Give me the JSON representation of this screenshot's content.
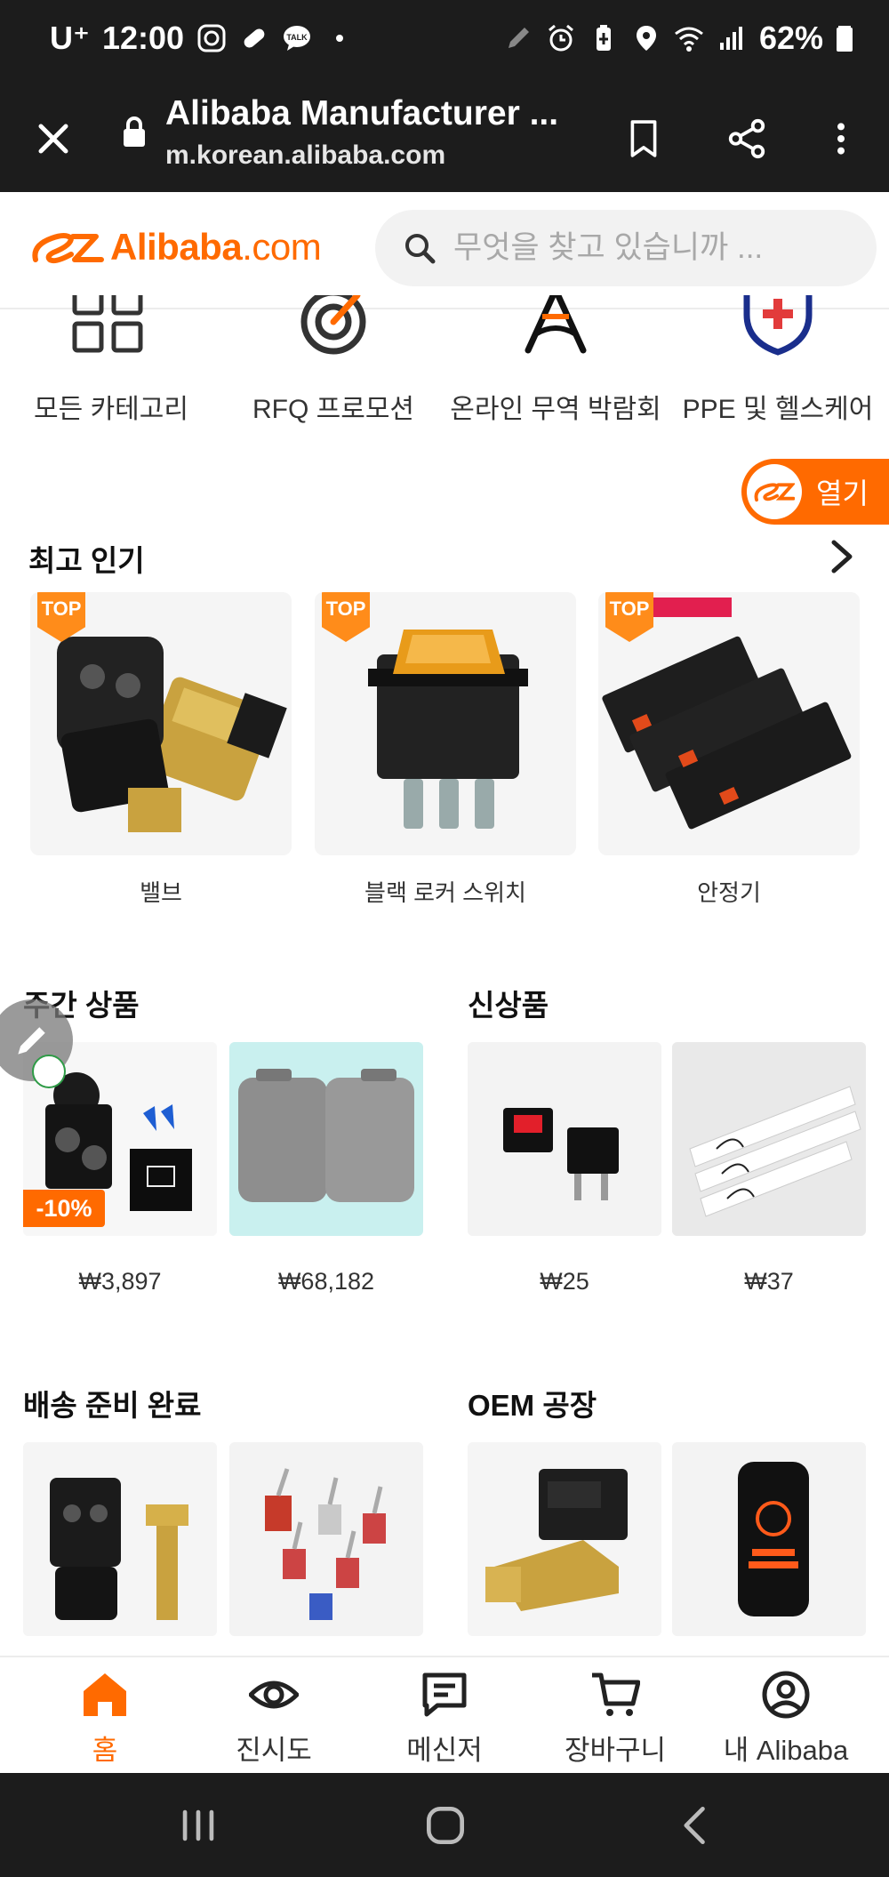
{
  "status_bar": {
    "carrier": "U⁺",
    "time": "12:00",
    "battery": "62%"
  },
  "browser": {
    "title": "Alibaba Manufacturer ...",
    "url": "m.korean.alibaba.com"
  },
  "header": {
    "logo_brand": "Alibaba",
    "logo_tld": ".com",
    "search_placeholder": "무엇을 찾고 있습니까 ..."
  },
  "categories": [
    {
      "label": "모든 카테고리",
      "icon": "grid-icon"
    },
    {
      "label": "RFQ 프로모션",
      "icon": "target-icon"
    },
    {
      "label": "온라인 무역 박람회",
      "icon": "tower-icon"
    },
    {
      "label": "PPE 및 헬스케어",
      "icon": "shield-cross-icon"
    }
  ],
  "open_app": {
    "label": "열기"
  },
  "top_section": {
    "title": "최고 인기",
    "badge": "TOP",
    "items": [
      {
        "name": "밸브"
      },
      {
        "name": "블랙 로커 스위치"
      },
      {
        "name": "안정기"
      }
    ]
  },
  "weekly": {
    "title": "주간 상품",
    "discount": "-10%",
    "items": [
      {
        "price": "₩3,897"
      },
      {
        "price": "₩68,182"
      }
    ]
  },
  "new_arrivals": {
    "title": "신상품",
    "items": [
      {
        "price": "₩25"
      },
      {
        "price": "₩37"
      }
    ]
  },
  "ready_to_ship": {
    "title": "배송 준비 완료"
  },
  "oem": {
    "title": "OEM 공장"
  },
  "bottom_nav": [
    {
      "label": "홈",
      "icon": "home-icon",
      "active": true
    },
    {
      "label": "진시도",
      "icon": "eye-icon",
      "active": false
    },
    {
      "label": "메신저",
      "icon": "message-icon",
      "active": false
    },
    {
      "label": "장바구니",
      "icon": "cart-icon",
      "active": false
    },
    {
      "label": "내 Alibaba",
      "icon": "user-circle-icon",
      "active": false
    }
  ],
  "colors": {
    "accent": "#ff6a00",
    "dark_bar": "#1c1c1c"
  }
}
